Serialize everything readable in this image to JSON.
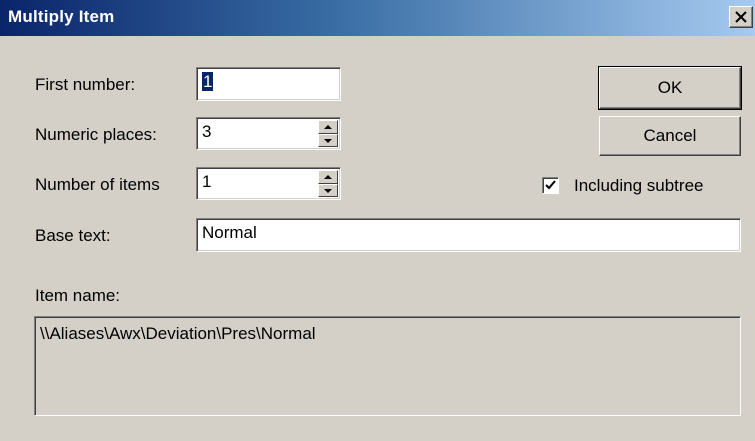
{
  "window": {
    "title": "Multiply Item"
  },
  "icons": {
    "close": "close-icon",
    "spin_up": "chevron-up-icon",
    "spin_down": "chevron-down-icon",
    "check": "check-icon"
  },
  "colors": {
    "title_start": "#0a246a",
    "title_end": "#a6caf0",
    "face": "#d4d0c8",
    "selection": "#0a246a"
  },
  "form": {
    "first_number": {
      "label": "First number:",
      "value": "1"
    },
    "numeric_places": {
      "label": "Numeric places:",
      "value": "3"
    },
    "number_of_items": {
      "label": "Number of items",
      "value": "1"
    },
    "base_text": {
      "label": "Base text:",
      "value": "Normal"
    },
    "item_name": {
      "label": "Item name:",
      "value": "\\\\Aliases\\Awx\\Deviation\\Pres\\Normal"
    }
  },
  "buttons": {
    "ok": "OK",
    "cancel": "Cancel"
  },
  "options": {
    "including_subtree": {
      "label": "Including subtree",
      "checked": true
    }
  }
}
